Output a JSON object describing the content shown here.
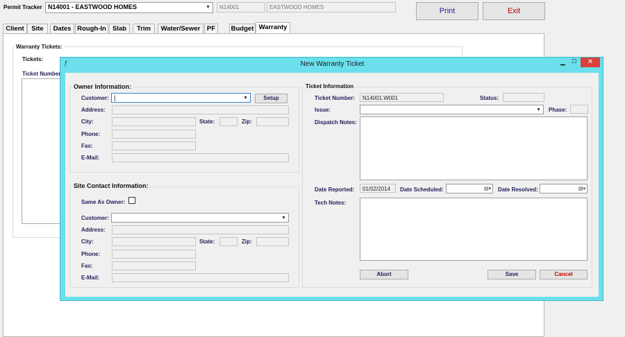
{
  "header": {
    "permit_label": "Permit Tracker",
    "permit_select": "N14001 - EASTWOOD HOMES",
    "permit_code": "N14001",
    "builder_name": "EASTWOOD HOMES",
    "print_label": "Print",
    "exit_label": "Exit"
  },
  "tabs": [
    "Client",
    "Site",
    "Dates",
    "Rough-In",
    "Slab",
    "Trim",
    "Water/Sewer",
    "PF",
    "Budget",
    "Warranty"
  ],
  "warranty_panel": {
    "group_title": "Warranty Tickets:",
    "tickets_label": "Tickets:",
    "ticket_number_label": "Ticket Number:"
  },
  "dialog": {
    "title": "New Warranty Ticket",
    "owner": {
      "title": "Owner Information:",
      "customer_label": "Customer:",
      "setup_label": "Setup",
      "address_label": "Address:",
      "city_label": "City:",
      "state_label": "State:",
      "zip_label": "Zip:",
      "phone_label": "Phone:",
      "fax_label": "Fax:",
      "email_label": "E-Mail:"
    },
    "site_contact": {
      "title": "Site Contact Information:",
      "same_as_owner_label": "Same As Owner:",
      "customer_label": "Customer:",
      "address_label": "Address:",
      "city_label": "City:",
      "state_label": "State:",
      "zip_label": "Zip:",
      "phone_label": "Phone:",
      "fax_label": "Fax:",
      "email_label": "E-Mail:"
    },
    "ticket": {
      "title": "Ticket Information",
      "ticket_number_label": "Ticket Number:",
      "ticket_number_value": "N14001.W001",
      "status_label": "Status:",
      "issue_label": "Issue:",
      "phase_label": "Phase:",
      "dispatch_notes_label": "Dispatch Notes:",
      "date_reported_label": "Date Reported:",
      "date_reported_value": "01/02/2014",
      "date_scheduled_label": "Date Scheduled:",
      "date_resolved_label": "Date Resolved:",
      "tech_notes_label": "Tech Notes:"
    },
    "buttons": {
      "abort": "Abort",
      "save": "Save",
      "cancel": "Cancel"
    }
  },
  "colors": {
    "title_bar": "#6be0ec",
    "close_button": "#d9403a",
    "label_text": "#1f1f5a",
    "cancel_text": "#c00000"
  }
}
